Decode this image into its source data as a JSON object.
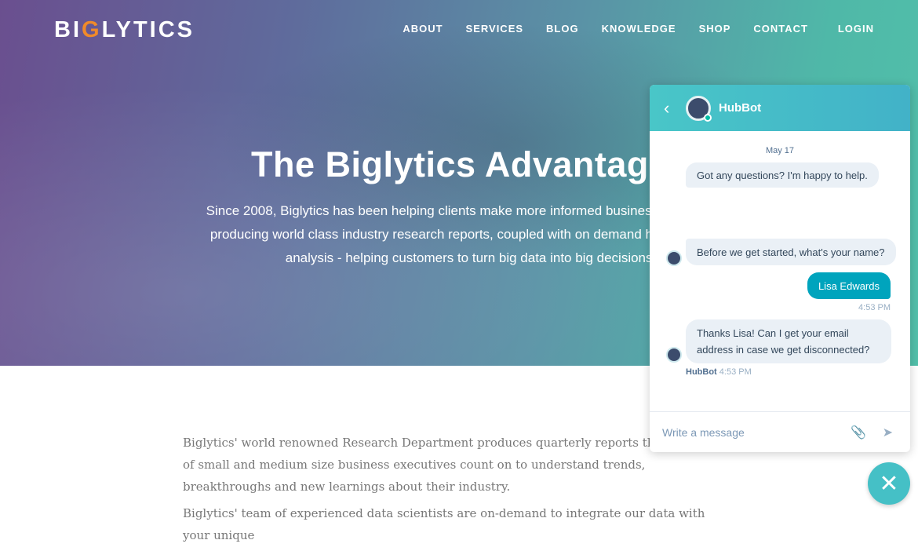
{
  "site": {
    "logo": "BIGLYTICS",
    "nav": [
      "ABOUT",
      "SERVICES",
      "BLOG",
      "KNOWLEDGE",
      "SHOP",
      "CONTACT",
      "LOGIN"
    ]
  },
  "hero": {
    "title": "The Biglytics Advantage",
    "subtitle": "Since 2008, Biglytics has been helping clients make more informed business decisions by producing world class industry research reports, coupled with on demand high level data analysis - helping customers to turn big data into big decisions."
  },
  "body": {
    "paragraphs": [
      "Biglytics' world renowned Research Department produces quarterly reports that hundreds of small and medium size business executives count on to understand trends, breakthroughs and new learnings about their industry.",
      "Biglytics' team of experienced data scientists are on-demand to integrate our data with your unique"
    ]
  },
  "chat": {
    "bot_name": "HubBot",
    "date": "May 17",
    "messages": [
      {
        "from": "bot",
        "text": "Got any questions? I'm happy to help."
      },
      {
        "from": "bot",
        "text": "Before we get started, what's your name?"
      },
      {
        "from": "user",
        "text": "Lisa Edwards",
        "time": "4:53 PM"
      },
      {
        "from": "bot",
        "text": "Thanks Lisa! Can I get your email address in case we get disconnected?",
        "sender": "HubBot",
        "time": "4:53 PM"
      }
    ],
    "input_placeholder": "Write a message"
  },
  "colors": {
    "accent": "#00a4bd",
    "header": "#45c0c6"
  }
}
